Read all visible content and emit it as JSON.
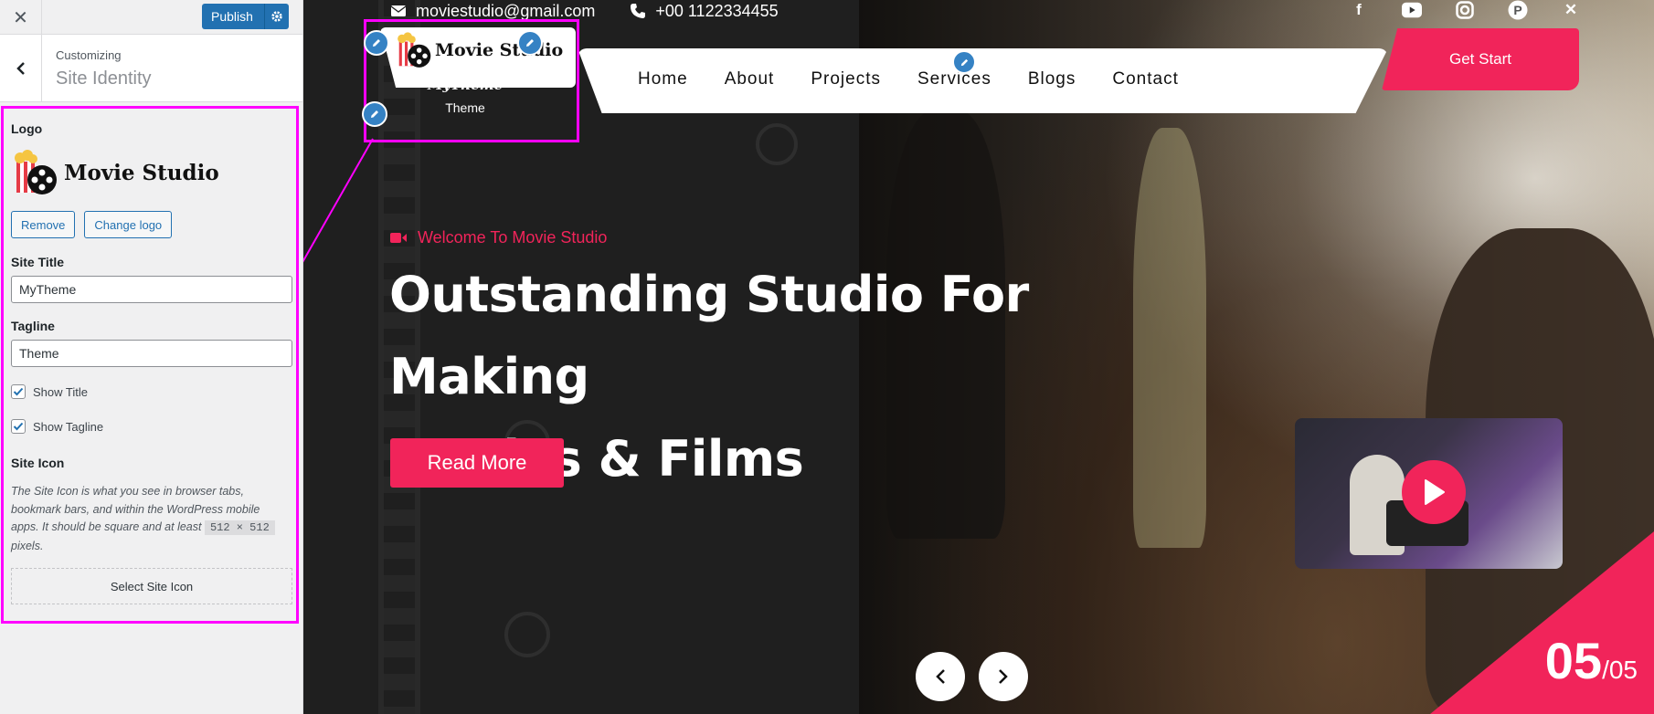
{
  "sidebar": {
    "close_icon": "close-icon",
    "publish_label": "Publish",
    "customizing_label": "Customizing",
    "section_title": "Site Identity",
    "logo_label": "Logo",
    "logo_text": "Movie Studio",
    "remove_label": "Remove",
    "change_logo_label": "Change logo",
    "site_title_label": "Site Title",
    "site_title_value": "MyTheme",
    "tagline_label": "Tagline",
    "tagline_value": "Theme",
    "show_title_label": "Show Title",
    "show_title_checked": true,
    "show_tagline_label": "Show Tagline",
    "show_tagline_checked": true,
    "site_icon_label": "Site Icon",
    "site_icon_desc": "The Site Icon is what you see in browser tabs, bookmark bars, and within the WordPress mobile apps. It should be square and at least",
    "site_icon_size": "512 × 512",
    "site_icon_desc_end": "pixels.",
    "select_site_icon_label": "Select Site Icon"
  },
  "preview": {
    "email": "moviestudio@gmail.com",
    "phone": "+00 1122334455",
    "socials": [
      "facebook-icon",
      "youtube-icon",
      "instagram-icon",
      "pinterest-icon",
      "x-icon"
    ],
    "logo_text": "Movie Studio",
    "site_title": "MyTheme",
    "site_tagline": "Theme",
    "nav": [
      "Home",
      "About",
      "Projects",
      "Services",
      "Blogs",
      "Contact"
    ],
    "get_start_label": "Get Start",
    "welcome_text": "Welcome To Movie Studio",
    "headline_line1": "Outstanding Studio For Making",
    "headline_line2": "Movies & Films",
    "read_more_label": "Read More",
    "slide_current": "05",
    "slide_total": "/05"
  },
  "colors": {
    "accent": "#f1245a",
    "wp_blue": "#2271b1",
    "focus_outline": "#ff00ff"
  }
}
